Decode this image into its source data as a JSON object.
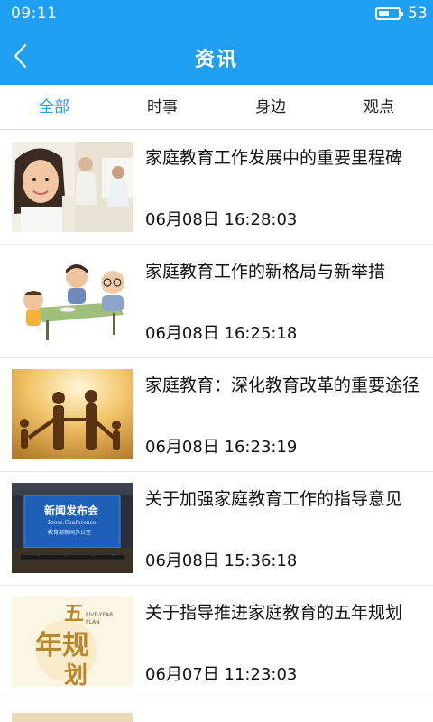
{
  "status_bar": {
    "time": "09:11",
    "battery_level": "53",
    "battery_fraction": 0.53
  },
  "header": {
    "title": "资讯",
    "back_icon": "chevron-left-icon"
  },
  "tabs": [
    {
      "label": "全部",
      "active": true
    },
    {
      "label": "时事",
      "active": false
    },
    {
      "label": "身边",
      "active": false
    },
    {
      "label": "观点",
      "active": false
    }
  ],
  "news": [
    {
      "title": "家庭教育工作发展中的重要里程碑",
      "time": "06月08日 16:28:03"
    },
    {
      "title": "家庭教育工作的新格局与新举措",
      "time": "06月08日 16:25:18"
    },
    {
      "title": "家庭教育：深化教育改革的重要途径",
      "time": "06月08日 16:23:19"
    },
    {
      "title": "关于加强家庭教育工作的指导意见",
      "time": "06月08日 15:36:18",
      "thumb_text": {
        "banner": "新闻发布会",
        "sub": "Press Conference",
        "office": "教育部新闻办公室"
      }
    },
    {
      "title": "关于指导推进家庭教育的五年规划",
      "time": "06月07日 11:23:03",
      "thumb_text": {
        "top": "五",
        "mid": "年规",
        "bottom": "划",
        "en1": "FIVE-YEAR",
        "en2": "PLAN"
      }
    }
  ],
  "colors": {
    "primary": "#1e9ff2",
    "text": "#111111",
    "divider": "#e6e6e6"
  }
}
